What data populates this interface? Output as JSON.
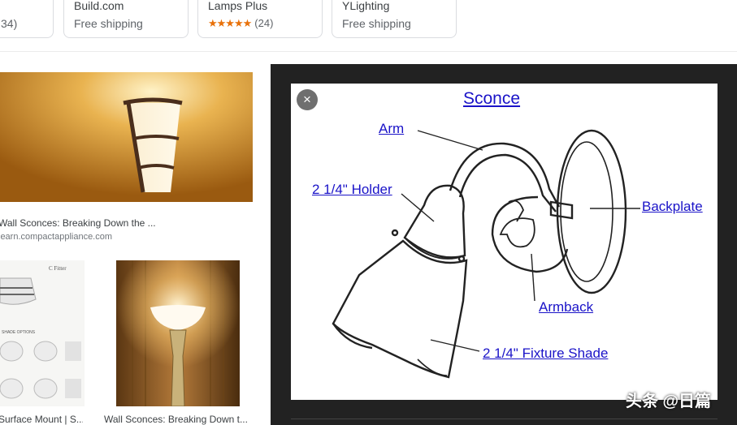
{
  "cards": [
    {
      "store": "",
      "sub": "34)"
    },
    {
      "store": "Build.com",
      "sub": "Free shipping"
    },
    {
      "store": "Lamps Plus",
      "stars": "★★★★★",
      "count": "(24)"
    },
    {
      "store": "YLighting",
      "sub": "Free shipping"
    }
  ],
  "results": [
    {
      "title": "Wall Sconces: Breaking Down the ...",
      "source": "learn.compactappliance.com"
    },
    {
      "title": "Surface Mount | S..."
    },
    {
      "title": "Wall Sconces: Breaking Down t..."
    }
  ],
  "thumb_text": {
    "brand": "C Fitter",
    "options": "SHADE OPTIONS"
  },
  "preview": {
    "close_icon": "×",
    "labels": {
      "title": "Sconce",
      "arm": "Arm",
      "holder": "2 1/4\" Holder",
      "backplate": "Backplate",
      "armback": "Armback",
      "fixture_shade": "2 1/4\" Fixture Shade"
    }
  },
  "watermark": {
    "text": "头条 @日篇",
    "small": "日篇"
  },
  "colors": {
    "label_blue": "#1a13c8",
    "panel_bg": "#222222",
    "star": "#e8710a"
  }
}
